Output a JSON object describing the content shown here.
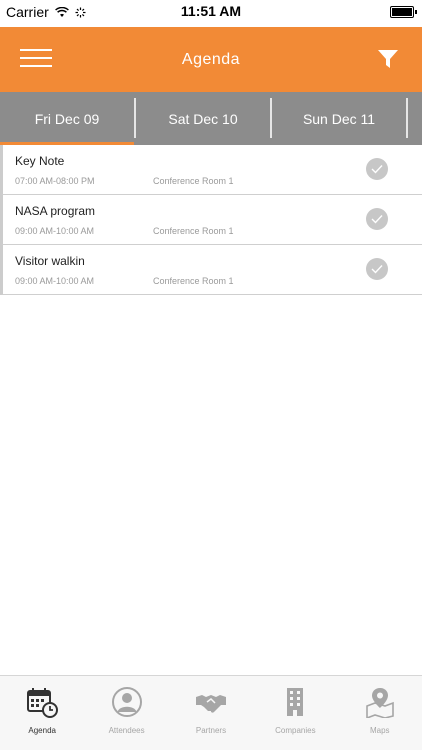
{
  "status_bar": {
    "carrier": "Carrier",
    "time": "11:51 AM"
  },
  "header": {
    "title": "Agenda",
    "icons": {
      "menu": "hamburger-menu-icon",
      "filter": "filter-icon"
    }
  },
  "date_tabs": [
    {
      "label": "Fri Dec 09",
      "active": true
    },
    {
      "label": "Sat Dec 10",
      "active": false
    },
    {
      "label": "Sun Dec 11",
      "active": false
    }
  ],
  "agenda": [
    {
      "title": "Key Note",
      "time": "07:00 AM-08:00 PM",
      "room": "Conference Room 1"
    },
    {
      "title": "NASA program",
      "time": "09:00 AM-10:00 AM",
      "room": "Conference Room 1"
    },
    {
      "title": "Visitor walkin",
      "time": "09:00 AM-10:00 AM",
      "room": "Conference Room 1"
    }
  ],
  "bottom_nav": [
    {
      "label": "Agenda",
      "icon": "calendar-clock-icon",
      "active": true
    },
    {
      "label": "Attendees",
      "icon": "person-icon",
      "active": false
    },
    {
      "label": "Partners",
      "icon": "handshake-icon",
      "active": false
    },
    {
      "label": "Companies",
      "icon": "building-icon",
      "active": false
    },
    {
      "label": "Maps",
      "icon": "map-pin-icon",
      "active": false
    }
  ],
  "colors": {
    "accent": "#f28a36",
    "tab_bar": "#8c8c8c",
    "check_gray": "#c7c7c7"
  }
}
